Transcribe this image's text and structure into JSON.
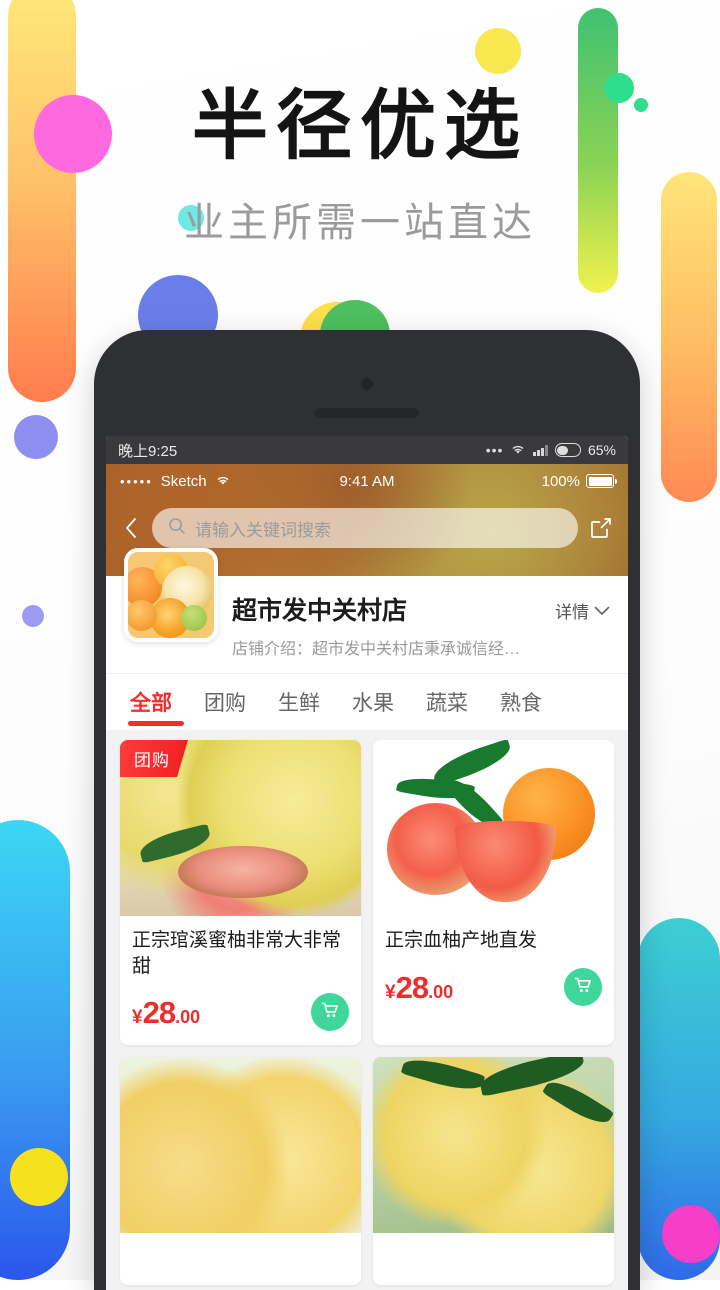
{
  "poster": {
    "title": "半径优选",
    "subtitle": "业主所需一站直达"
  },
  "android_status": {
    "time": "晚上9:25",
    "dots": "•••",
    "wifi_icon": "wifi-icon",
    "signal_icon": "signal-icon",
    "battery_icon": "battery-icon",
    "battery_pct": "65%"
  },
  "ios_status": {
    "signal_dots": "•••••",
    "carrier": "Sketch",
    "wifi_icon": "wifi-icon",
    "time": "9:41 AM",
    "battery_pct": "100%",
    "battery_icon": "battery-icon"
  },
  "header": {
    "back_icon": "back-chevron-icon",
    "share_icon": "share-icon",
    "search_icon": "search-icon",
    "search_value": "",
    "search_placeholder": "请输入关键词搜索"
  },
  "store": {
    "logo_icon": "store-logo-fruit",
    "name": "超市发中关村店",
    "description": "店铺介绍：超市发中关村店秉承诚信经…",
    "detail_label": "详情",
    "detail_icon": "chevron-down-icon"
  },
  "tabs": [
    {
      "label": "全部",
      "active": true
    },
    {
      "label": "团购",
      "active": false
    },
    {
      "label": "生鲜",
      "active": false
    },
    {
      "label": "水果",
      "active": false
    },
    {
      "label": "蔬菜",
      "active": false
    },
    {
      "label": "熟食",
      "active": false
    }
  ],
  "products": [
    {
      "badge": "团购",
      "title": "正宗琯溪蜜柚非常大非常甜",
      "currency": "¥",
      "price_int": "28",
      "price_dec": ".00",
      "cart_icon": "shopping-cart-icon"
    },
    {
      "badge": "",
      "title": "正宗血柚产地直发",
      "currency": "¥",
      "price_int": "28",
      "price_dec": ".00",
      "cart_icon": "shopping-cart-icon"
    },
    {
      "badge": "",
      "title": "",
      "currency": "",
      "price_int": "",
      "price_dec": "",
      "cart_icon": "shopping-cart-icon"
    },
    {
      "badge": "",
      "title": "",
      "currency": "",
      "price_int": "",
      "price_dec": "",
      "cart_icon": "shopping-cart-icon"
    }
  ],
  "colors": {
    "accent_red": "#f22e2e",
    "price_red": "#f02d2d",
    "cart_green": "#3ed69a",
    "phone_bezel": "#2f3033"
  }
}
